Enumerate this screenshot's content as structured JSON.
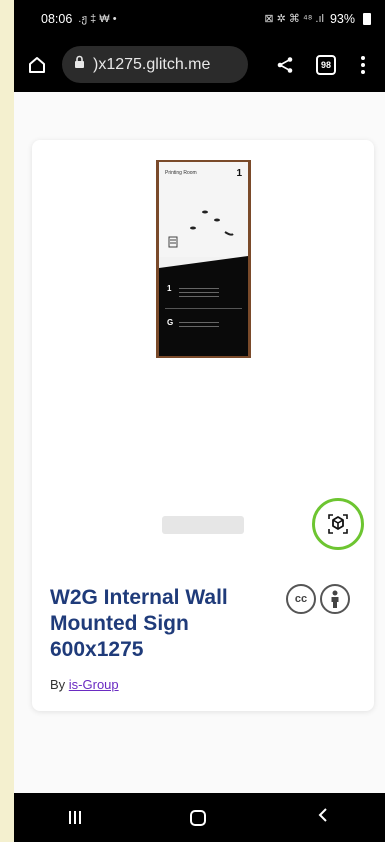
{
  "status_bar": {
    "time": "08:06",
    "left_glyphs": ".ჟ ‡ ₩ •",
    "right_glyphs": "⊠ ✲ ⌘ ⁴⁸ .ıl",
    "battery": "93%"
  },
  "browser": {
    "url": ")x1275.glitch.me",
    "tab_count": "98"
  },
  "card": {
    "sign_title": "Printing Room",
    "sign_number": "1",
    "sign_row1": "1",
    "sign_row2": "G",
    "title": "W2G Internal Wall Mounted Sign 600x1275",
    "byline_prefix": "By ",
    "author": "is-Group",
    "license_cc": "cc"
  },
  "colors": {
    "accent_ring": "#6dc531",
    "title": "#1f3b7a",
    "link": "#6a2bc2"
  }
}
